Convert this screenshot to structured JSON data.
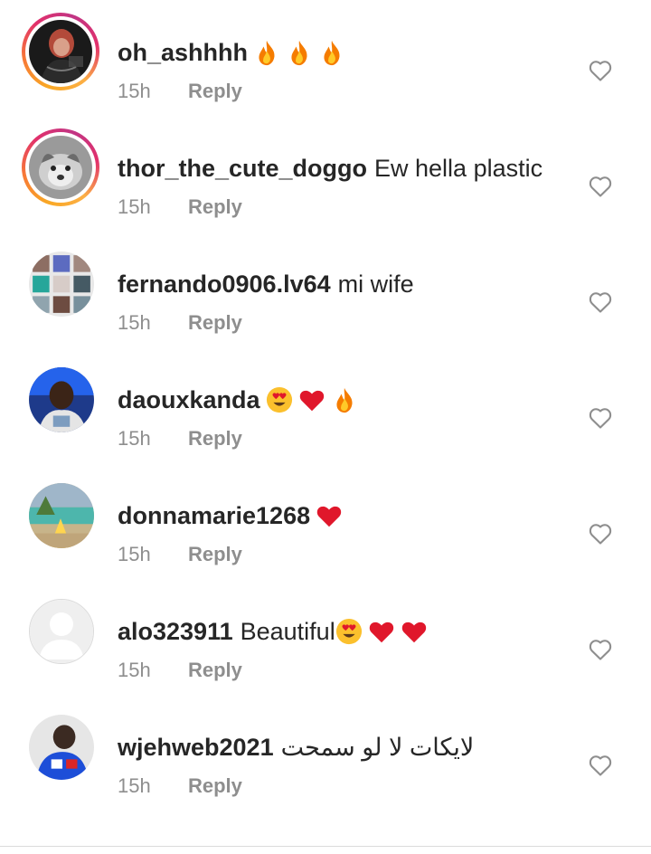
{
  "comments": [
    {
      "username": "oh_ashhhh",
      "text": "",
      "emojis": [
        "fire-icon",
        "fire-icon",
        "fire-icon"
      ],
      "time": "15h",
      "reply": "Reply",
      "story_ring": true,
      "avatar": "avatar-photo-person-dark"
    },
    {
      "username": "thor_the_cute_doggo",
      "text": "Ew hella plastic",
      "emojis": [],
      "time": "15h",
      "reply": "Reply",
      "story_ring": true,
      "avatar": "avatar-photo-dog"
    },
    {
      "username": "fernando0906.lv64",
      "text": "mi wife",
      "emojis": [],
      "time": "15h",
      "reply": "Reply",
      "story_ring": false,
      "avatar": "avatar-photo-collage"
    },
    {
      "username": "daouxkanda",
      "text": "",
      "emojis": [
        "heart-eyes-icon",
        "red-heart-icon",
        "fire-icon"
      ],
      "time": "15h",
      "reply": "Reply",
      "story_ring": false,
      "avatar": "avatar-photo-person-blue"
    },
    {
      "username": "donnamarie1268",
      "text": "",
      "emojis": [
        "red-heart-icon"
      ],
      "time": "15h",
      "reply": "Reply",
      "story_ring": false,
      "avatar": "avatar-photo-pool"
    },
    {
      "username": "alo323911",
      "text": "Beautiful",
      "emojis": [
        "heart-eyes-icon",
        "red-heart-icon",
        "red-heart-icon"
      ],
      "time": "15h",
      "reply": "Reply",
      "story_ring": false,
      "avatar": "avatar-default-placeholder"
    },
    {
      "username": "wjehweb2021",
      "text": "لايكات لا لو سمحت",
      "emojis": [],
      "time": "15h",
      "reply": "Reply",
      "story_ring": false,
      "avatar": "avatar-photo-person-jersey"
    }
  ],
  "colors": {
    "text_primary": "#262626",
    "text_secondary": "#8e8e8e",
    "heart_red": "#e0172b",
    "divider": "#dbdbdb"
  }
}
